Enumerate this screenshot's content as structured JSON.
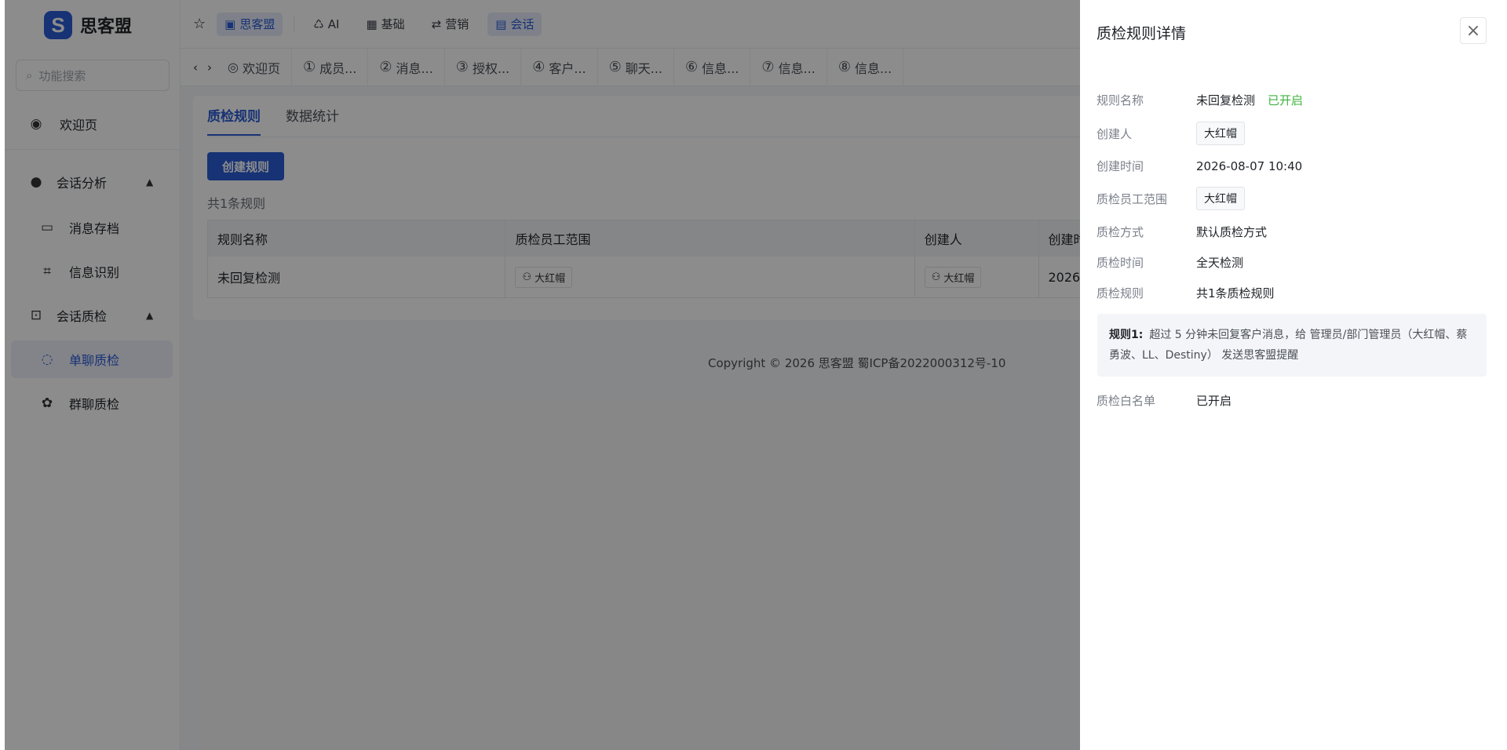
{
  "brand": {
    "name": "思客盟",
    "mark": "S"
  },
  "search": {
    "placeholder": "功能搜索"
  },
  "sidebar": {
    "welcome": "欢迎页",
    "group1": "会话分析",
    "group1_items": [
      "消息存档",
      "信息识别"
    ],
    "group2": "会话质检",
    "group2_items": [
      "单聊质检",
      "群聊质检"
    ]
  },
  "topbar": {
    "items": [
      {
        "label": "思客盟",
        "active": true,
        "icon": "box-icon"
      },
      {
        "label": "AI",
        "active": false,
        "icon": "ai-icon"
      },
      {
        "label": "基础",
        "active": false,
        "icon": "grid-icon"
      },
      {
        "label": "营销",
        "active": false,
        "icon": "share-icon"
      },
      {
        "label": "会话",
        "active": true,
        "icon": "chat-icon"
      }
    ]
  },
  "tabs": [
    {
      "num": "",
      "label": "欢迎页"
    },
    {
      "num": "①",
      "label": "成员..."
    },
    {
      "num": "②",
      "label": "消息..."
    },
    {
      "num": "③",
      "label": "授权..."
    },
    {
      "num": "④",
      "label": "客户..."
    },
    {
      "num": "⑤",
      "label": "聊天..."
    },
    {
      "num": "⑥",
      "label": "信息..."
    },
    {
      "num": "⑦",
      "label": "信息..."
    },
    {
      "num": "⑧",
      "label": "信息..."
    }
  ],
  "page": {
    "tab_rules": "质检规则",
    "tab_stats": "数据统计",
    "create_button": "创建规则",
    "count": "共1条规则",
    "columns": [
      "规则名称",
      "质检员工范围",
      "创建人",
      "创建时"
    ],
    "rows": [
      [
        "未回复检测",
        "大红帽",
        "大红帽",
        "2026-"
      ]
    ]
  },
  "copyright": "Copyright © 2026 思客盟 蜀ICP备2022000312号-10",
  "drawer": {
    "title": "质检规则详情",
    "fields": {
      "name_label": "规则名称",
      "name": "未回复检测",
      "status": "已开启",
      "creator_label": "创建人",
      "creator": "大红帽",
      "time_label": "创建时间",
      "time": "2026-08-07 10:40",
      "scope_label": "质检员工范围",
      "scope": "大红帽",
      "method_label": "质检方式",
      "method": "默认质检方式",
      "period_label": "质检时间",
      "period": "全天检测",
      "rules_label": "质检规则",
      "rules": "共1条质检规则",
      "rule1_title": "规则1:",
      "rule1_text": "超过 5 分钟未回复客户消息，给 管理员/部门管理员（大红帽、蔡勇波、LL、Destiny） 发送思客盟提醒",
      "whitelist_label": "质检白名单",
      "whitelist": "已开启"
    }
  }
}
